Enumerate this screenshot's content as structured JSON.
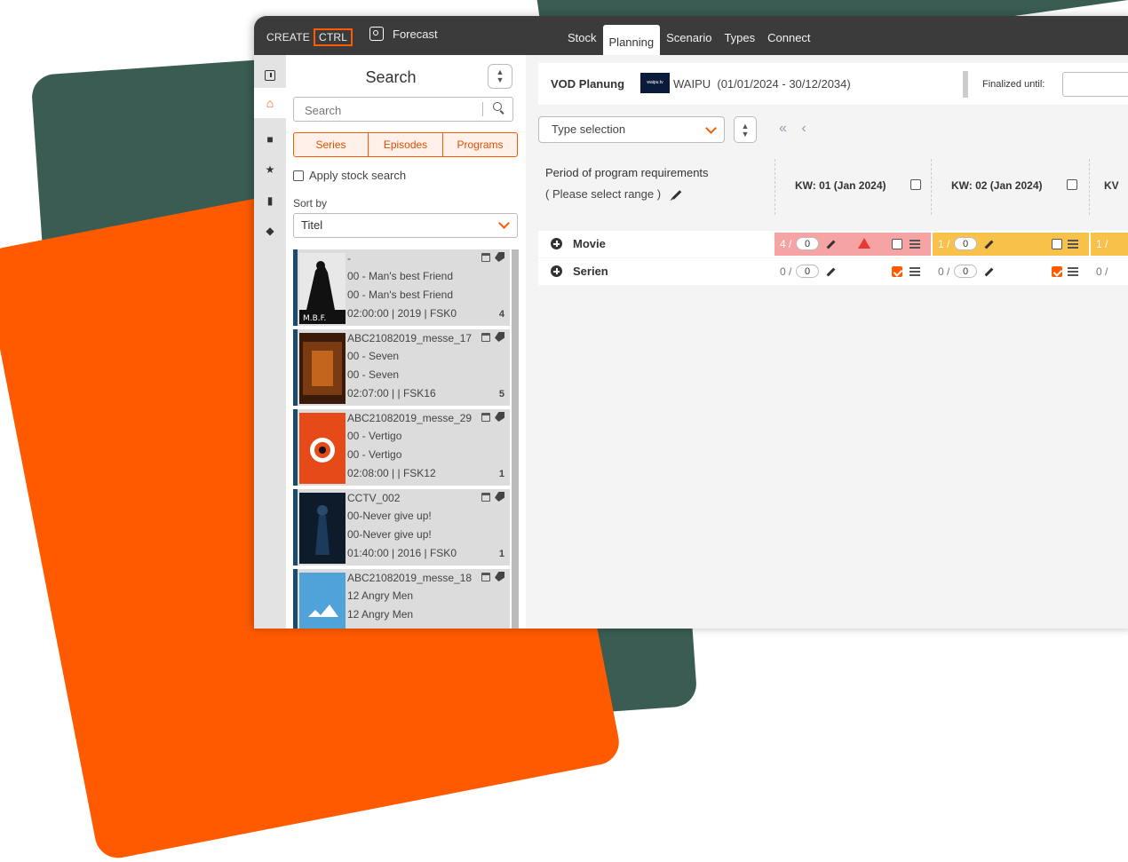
{
  "brand": {
    "create": "CREATE",
    "ctrl": "CTRL"
  },
  "forecast": {
    "label": "Forecast"
  },
  "tabs": [
    "Stock",
    "Planning",
    "Scenario",
    "Types",
    "Connect"
  ],
  "search_panel": {
    "title": "Search",
    "search_placeholder": "Search",
    "filters": [
      "Series",
      "Episodes",
      "Programs"
    ],
    "apply_stock_search": "Apply stock search",
    "sort_by_label": "Sort by",
    "sort_by_value": "Titel",
    "items": [
      {
        "title": "-",
        "line1": "00 - Man's best Friend",
        "line2": "00 - Man's best Friend",
        "meta": "02:00:00 | 2019 | FSK0",
        "count": "4"
      },
      {
        "title": "ABC21082019_messe_17",
        "line1": "00 - Seven",
        "line2": "00 - Seven",
        "meta": "02:07:00 | | FSK16",
        "count": "5"
      },
      {
        "title": "ABC21082019_messe_29",
        "line1": "00 - Vertigo",
        "line2": "00 - Vertigo",
        "meta": "02:08:00 | | FSK12",
        "count": "1"
      },
      {
        "title": "CCTV_002",
        "line1": "00-Never give up!",
        "line2": "00-Never give up!",
        "meta": "01:40:00 | 2016 | FSK0",
        "count": "1"
      },
      {
        "title": "ABC21082019_messe_18",
        "line1": "12 Angry Men",
        "line2": "12 Angry Men",
        "meta": "",
        "count": ""
      }
    ]
  },
  "planning": {
    "name": "VOD Planung",
    "logo_text": "waipu.tv",
    "channel": "WAIPU",
    "range": "(01/01/2024 - 30/12/2034)",
    "finalized_label": "Finalized until:",
    "type_selection": "Type selection",
    "nav_arrows": "« ‹",
    "period_title": "Period of program requirements",
    "period_subtitle": "( Please select range )",
    "weeks": [
      "KW: 01 (Jan 2024)",
      "KW: 02 (Jan 2024)",
      "KV"
    ],
    "rows": [
      {
        "label": "Movie",
        "cells": [
          {
            "num": "4 /",
            "val": "0",
            "status": "red",
            "checked": false
          },
          {
            "num": "1 /",
            "val": "0",
            "status": "yellow",
            "checked": false
          },
          {
            "num": "1 /"
          }
        ]
      },
      {
        "label": "Serien",
        "cells": [
          {
            "num": "0 /",
            "val": "0",
            "status": "none",
            "checked": true
          },
          {
            "num": "0 /",
            "val": "0",
            "status": "none",
            "checked": true
          },
          {
            "num": "0 /"
          }
        ]
      }
    ]
  },
  "colors": {
    "accent": "#ff5a00",
    "bg_green": "#3a5c52",
    "rail_dark": "#1b4c6b",
    "warn": "#e53935",
    "yellow": "#f8c14a",
    "red_cell": "#f5a3a3"
  }
}
